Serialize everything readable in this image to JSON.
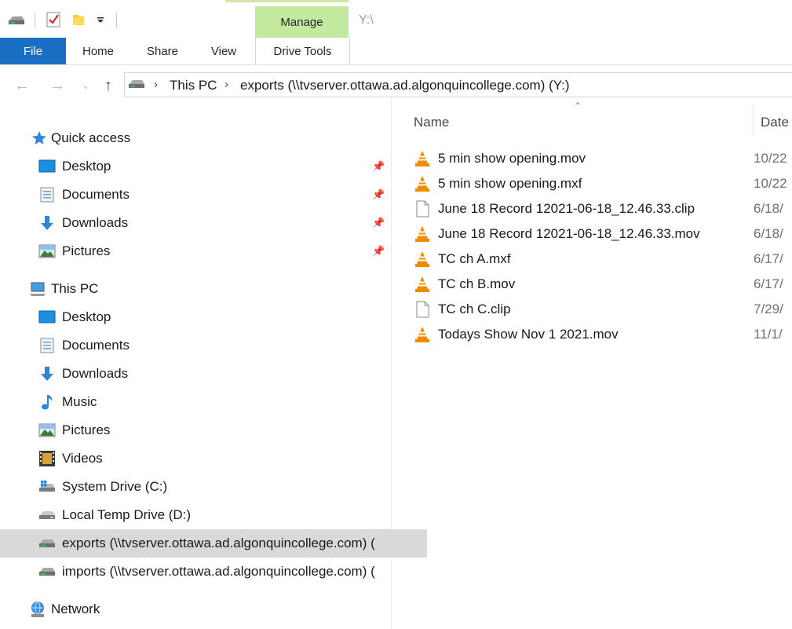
{
  "title_bar": {
    "path": "Y:\\",
    "context_tab": "Manage",
    "quick_access_icons": [
      "drive-icon",
      "properties-check-icon",
      "new-folder-icon",
      "customize-dropdown-icon"
    ]
  },
  "ribbon": {
    "tabs": [
      "File",
      "Home",
      "Share",
      "View",
      "Drive Tools"
    ]
  },
  "address_bar": {
    "breadcrumbs": [
      "This PC",
      "exports (\\\\tvserver.ottawa.ad.algonquincollege.com) (Y:)"
    ]
  },
  "nav_pane": {
    "quick_access": {
      "label": "Quick access",
      "items": [
        {
          "label": "Desktop",
          "icon": "desktop-icon",
          "pinned": true
        },
        {
          "label": "Documents",
          "icon": "documents-icon",
          "pinned": true
        },
        {
          "label": "Downloads",
          "icon": "downloads-icon",
          "pinned": true
        },
        {
          "label": "Pictures",
          "icon": "pictures-icon",
          "pinned": true
        }
      ]
    },
    "this_pc": {
      "label": "This PC",
      "items": [
        {
          "label": "Desktop",
          "icon": "desktop-icon"
        },
        {
          "label": "Documents",
          "icon": "documents-icon"
        },
        {
          "label": "Downloads",
          "icon": "downloads-icon"
        },
        {
          "label": "Music",
          "icon": "music-icon"
        },
        {
          "label": "Pictures",
          "icon": "pictures-icon"
        },
        {
          "label": "Videos",
          "icon": "videos-icon"
        },
        {
          "label": "System Drive (C:)",
          "icon": "windows-drive-icon"
        },
        {
          "label": "Local Temp Drive (D:)",
          "icon": "drive-icon"
        },
        {
          "label": "exports (\\\\tvserver.ottawa.ad.algonquincollege.com) (",
          "icon": "network-drive-icon",
          "selected": true
        },
        {
          "label": "imports (\\\\tvserver.ottawa.ad.algonquincollege.com) (",
          "icon": "network-drive-icon"
        }
      ]
    },
    "network": {
      "label": "Network",
      "icon": "network-icon"
    }
  },
  "file_list": {
    "columns": [
      "Name",
      "Date"
    ],
    "files": [
      {
        "name": "5 min show opening.mov",
        "date": "10/22",
        "icon": "vlc-cone-icon"
      },
      {
        "name": "5 min show opening.mxf",
        "date": "10/22",
        "icon": "vlc-cone-icon"
      },
      {
        "name": "June 18 Record 12021-06-18_12.46.33.clip",
        "date": "6/18/",
        "icon": "blank-file-icon"
      },
      {
        "name": "June 18 Record 12021-06-18_12.46.33.mov",
        "date": "6/18/",
        "icon": "vlc-cone-icon"
      },
      {
        "name": "TC ch A.mxf",
        "date": "6/17/",
        "icon": "vlc-cone-icon"
      },
      {
        "name": "TC ch B.mov",
        "date": "6/17/",
        "icon": "vlc-cone-icon"
      },
      {
        "name": "TC ch C.clip",
        "date": "7/29/",
        "icon": "blank-file-icon"
      },
      {
        "name": "Todays Show Nov 1 2021.mov",
        "date": "11/1/",
        "icon": "vlc-cone-icon"
      }
    ]
  },
  "colors": {
    "file_tab": "#1a6fc4",
    "manage_tab": "#c4eaa0",
    "selected_row": "#d9d9d9",
    "vlc_orange": "#f08c00"
  }
}
